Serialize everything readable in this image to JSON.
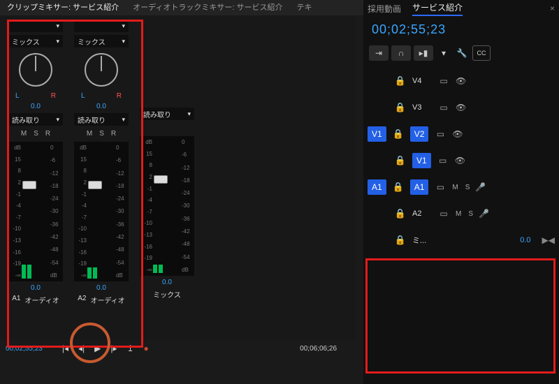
{
  "top_tabs": {
    "clip_mixer": "クリップミキサー: サービス紹介",
    "audio_track_mixer": "オーディオトラックミキサー: サービス紹介",
    "text": "テキ"
  },
  "mixer": {
    "mix_label": "ミックス",
    "read_label": "読み取り",
    "msr": {
      "m": "M",
      "s": "S",
      "r": "R"
    },
    "lr": {
      "l": "L",
      "r": "R"
    },
    "pan_value": "0.0",
    "scale": [
      "dB",
      "15",
      "8",
      "2",
      "-1",
      "-4",
      "-7",
      "-10",
      "-13",
      "-16",
      "-19",
      "-∞"
    ],
    "scale_right": [
      "0",
      "-6",
      "-12",
      "-18",
      "-24",
      "-30",
      "-36",
      "-42",
      "-48",
      "-54",
      "dB"
    ],
    "fader_value": "0.0",
    "db_unit": "dB",
    "channels": [
      {
        "id": "A1",
        "name": "オーディオ"
      },
      {
        "id": "A2",
        "name": "オーディオ"
      }
    ],
    "mix_bus_label": "ミックス"
  },
  "bottom": {
    "timecode": "00;02;55;23",
    "duration": "00;06;06;26"
  },
  "right": {
    "tabs": {
      "recruit": "採用動画",
      "service": "サービス紹介"
    },
    "timecode": "00;02;55;23",
    "video_tracks": [
      {
        "name": "V4"
      },
      {
        "name": "V3"
      }
    ],
    "video_tracks_selected": {
      "src": "V1",
      "dest": "V2",
      "below": "V1"
    },
    "audio_tracks": [
      {
        "src": "A1",
        "dest": "A1",
        "selected": true
      },
      {
        "name": "A2",
        "selected": false
      }
    ],
    "mix_track": {
      "name": "ミ...",
      "value": "0.0"
    },
    "ms": {
      "m": "M",
      "s": "S"
    }
  }
}
